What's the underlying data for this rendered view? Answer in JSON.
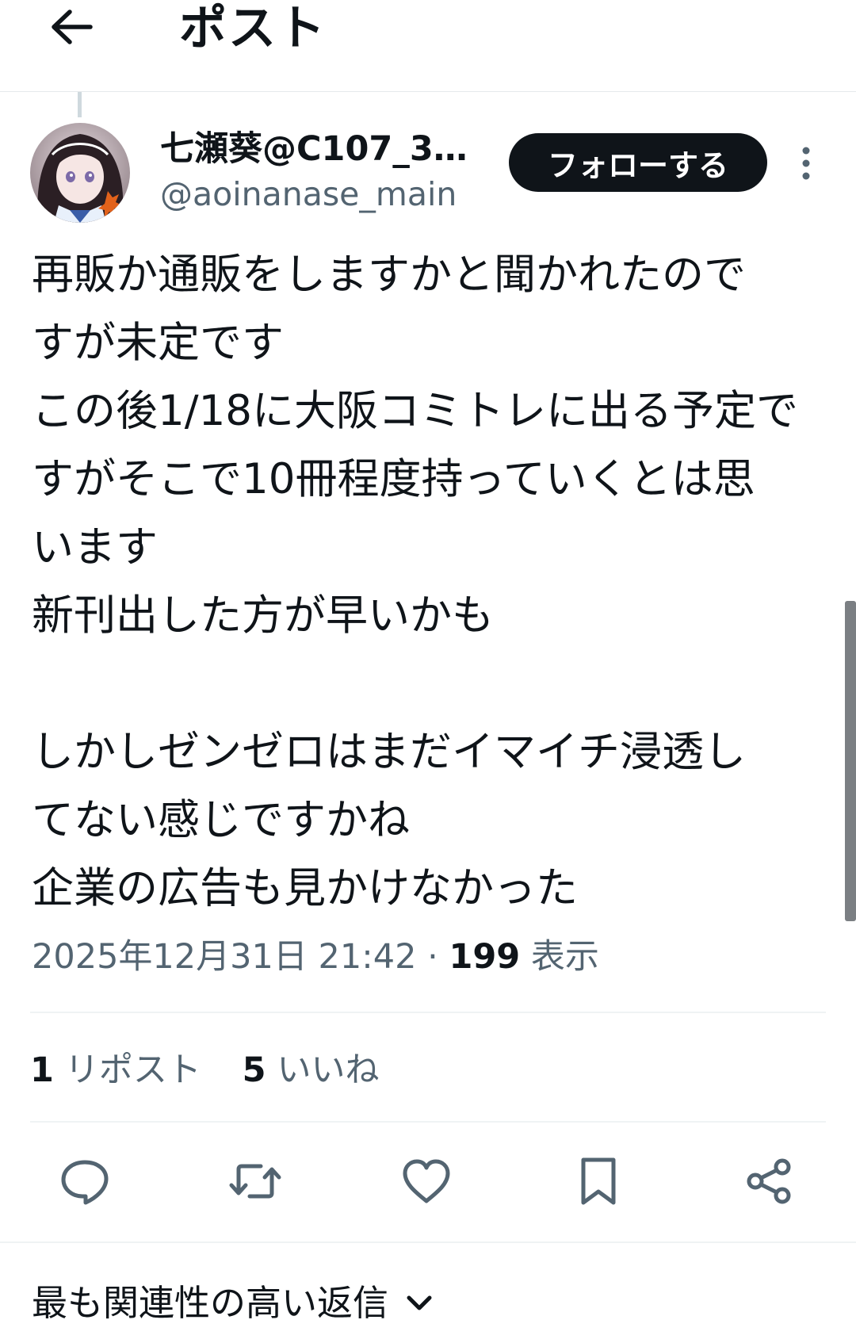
{
  "header": {
    "title": "ポスト",
    "back_icon": "arrow-left-icon"
  },
  "author": {
    "display_name": "七瀬葵@C107_31...",
    "handle": "@aoinanase_main",
    "follow_label": "フォローする",
    "more_icon": "vertical-dots-icon"
  },
  "post": {
    "text": "再販か通販をしますかと聞かれたので\nすが未定です\nこの後1/18に大阪コミトレに出る予定で\nすがそこで10冊程度持っていくとは思\nいます\n新刊出した方が早いかも\n\nしかしゼンゼロはまだイマイチ浸透し\nてない感じですかね\n企業の広告も見かけなかった",
    "timestamp": "2025年12月31日 21:42",
    "separator": "·",
    "views_count": "199",
    "views_label": "表示"
  },
  "stats": {
    "reposts_count": "1",
    "reposts_label": "リポスト",
    "likes_count": "5",
    "likes_label": "いいね"
  },
  "actions": {
    "icons": [
      "reply-icon",
      "repost-icon",
      "like-icon",
      "bookmark-icon",
      "share-icon"
    ]
  },
  "replies": {
    "sort_label": "最も関連性の高い返信",
    "sort_icon": "chevron-down-icon"
  },
  "colors": {
    "text": "#0f1419",
    "secondary": "#536471",
    "button_bg": "#0f1419",
    "divider": "#eff3f4"
  }
}
